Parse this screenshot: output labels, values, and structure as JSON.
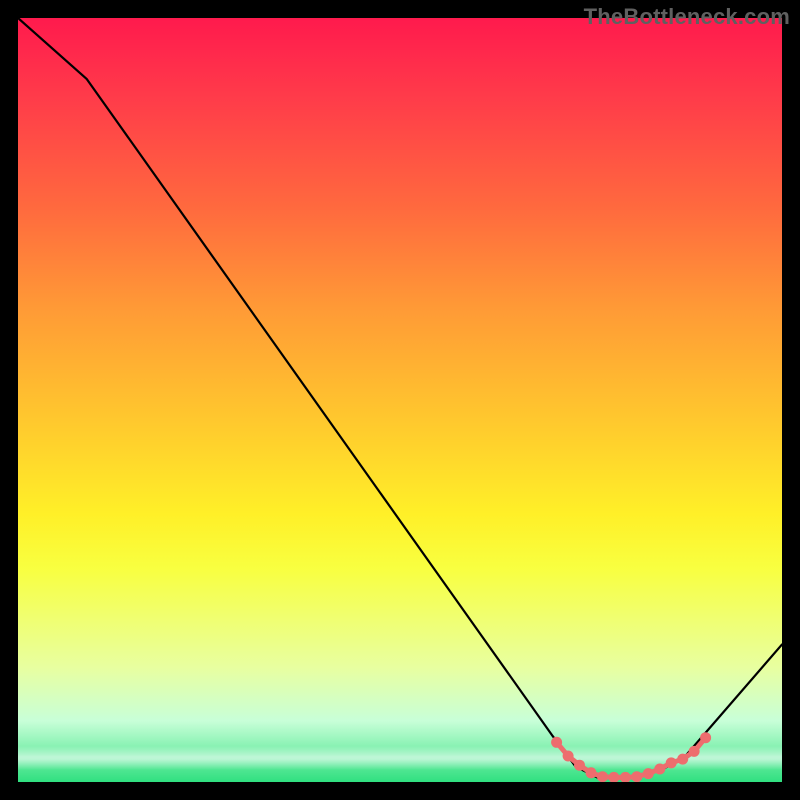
{
  "watermark": "TheBottleneck.com",
  "chart_data": {
    "type": "line",
    "title": "",
    "xlabel": "",
    "ylabel": "",
    "xlim": [
      0,
      100
    ],
    "ylim": [
      0,
      100
    ],
    "series": [
      {
        "name": "bottleneck-curve",
        "x": [
          0,
          9,
          70,
          73,
          76,
          80,
          84,
          87,
          100
        ],
        "y": [
          100,
          92,
          6,
          2,
          0.5,
          0.5,
          1.5,
          3,
          18
        ]
      }
    ],
    "markers": {
      "name": "highlighted-range",
      "x": [
        70.5,
        72,
        73.5,
        75,
        76.5,
        78,
        79.5,
        81,
        82.5,
        84,
        85.5,
        87,
        88.5,
        90
      ],
      "y": [
        5.2,
        3.4,
        2.2,
        1.2,
        0.7,
        0.6,
        0.6,
        0.7,
        1.1,
        1.7,
        2.5,
        3.0,
        4.0,
        5.8
      ]
    },
    "gradient_stops": [
      {
        "offset": 0,
        "color": "#ff1a4d"
      },
      {
        "offset": 25,
        "color": "#ff6a3e"
      },
      {
        "offset": 52,
        "color": "#ffc62e"
      },
      {
        "offset": 72,
        "color": "#f8ff40"
      },
      {
        "offset": 92,
        "color": "#c8ffd8"
      },
      {
        "offset": 100,
        "color": "#30e080"
      }
    ]
  }
}
